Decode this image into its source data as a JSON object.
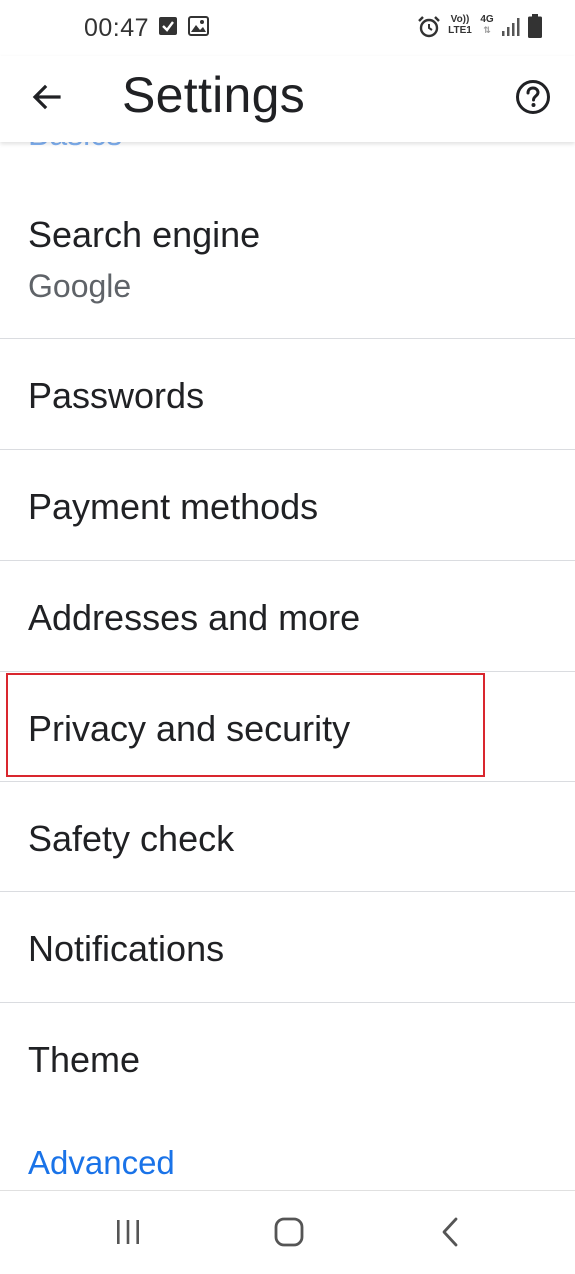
{
  "status_bar": {
    "time": "00:47",
    "icons": [
      "checkbox-notification-icon",
      "image-notification-icon",
      "alarm-icon",
      "volte-icon",
      "4g-icon",
      "signal-icon",
      "battery-icon"
    ],
    "volte_top": "Vo))",
    "volte_bottom": "LTE1",
    "network_type": "4G"
  },
  "app_bar": {
    "title": "Settings",
    "back_icon": "arrow-back-icon",
    "help_icon": "help-circle-icon"
  },
  "settings": {
    "section_peek": "Basics",
    "items": [
      {
        "title": "Search engine",
        "subtitle": "Google"
      },
      {
        "title": "Passwords"
      },
      {
        "title": "Payment methods"
      },
      {
        "title": "Addresses and more"
      },
      {
        "title": "Privacy and security",
        "highlighted": true
      },
      {
        "title": "Safety check"
      },
      {
        "title": "Notifications"
      },
      {
        "title": "Theme"
      }
    ],
    "advanced_label": "Advanced"
  },
  "nav_bar": {
    "buttons": [
      "recent-apps-icon",
      "home-icon",
      "back-nav-icon"
    ]
  },
  "colors": {
    "accent": "#1a73e8",
    "highlight": "#d9262e",
    "divider": "#dadce0",
    "text_primary": "#202124",
    "text_secondary": "#5f6368"
  }
}
